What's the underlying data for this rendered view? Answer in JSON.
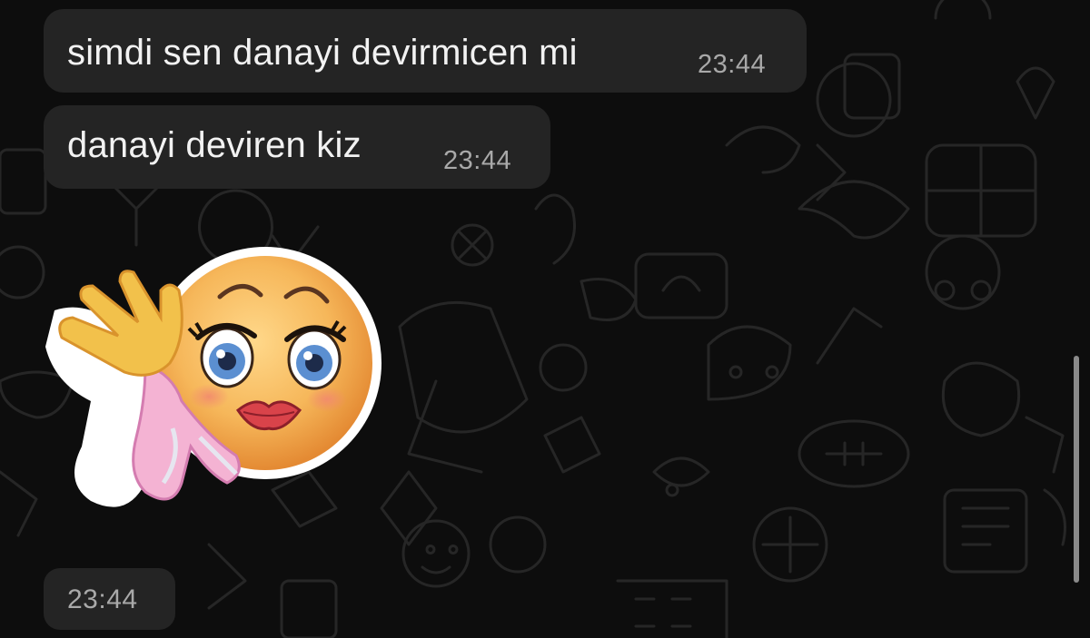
{
  "chat": {
    "messages": [
      {
        "text": "simdi sen danayi devirmicen mi",
        "time": "23:44"
      },
      {
        "text": "danayi deviren kiz",
        "time": "23:44"
      }
    ],
    "sticker": {
      "time": "23:44",
      "icon": "flirty-smiley-sticker"
    }
  },
  "colors": {
    "background": "#0d0d0d",
    "bubble": "#242424",
    "text": "#f2f2f2",
    "time": "#a9a9a9"
  }
}
